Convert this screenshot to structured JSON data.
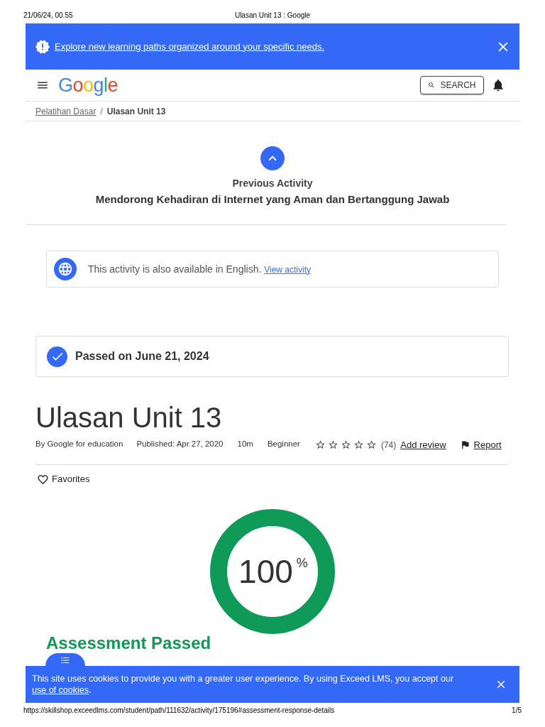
{
  "print_header": {
    "date": "21/06/24, 00.55",
    "title": "Ulasan Unit 13 : Google"
  },
  "announcement": {
    "text": "Explore new learning paths organized around your specific needs."
  },
  "nav": {
    "logo": "Google",
    "search_button": "SEARCH"
  },
  "breadcrumb": {
    "separator": "/",
    "items": [
      {
        "label": "Pelatihan Dasar",
        "kind": "link"
      },
      {
        "label": "Ulasan Unit 13",
        "kind": "current"
      }
    ]
  },
  "previous_activity": {
    "label": "Previous Activity",
    "title": "Mendorong Kehadiran di Internet yang Aman dan Bertanggung Jawab"
  },
  "language_notice": {
    "text": "This activity is also available in English.",
    "link": "View activity"
  },
  "status": {
    "text": "Passed on June 21, 2024"
  },
  "title": "Ulasan Unit 13",
  "meta": {
    "author": "By Google for education",
    "published": "Published: Apr 27, 2020",
    "duration": "10m",
    "difficulty": "Beginner",
    "rating": {
      "stars": 0,
      "count": "(74)"
    },
    "add_review": "Add review",
    "report": "Report"
  },
  "favorites": {
    "label": "Favorites",
    "on": false
  },
  "score": {
    "level": 1,
    "value": "100",
    "unit": "%"
  },
  "result": {
    "title": "Assessment Passed"
  },
  "cookie_banner": {
    "text": "This site uses cookies to provide you with a greater user experience. By using Exceed LMS, you accept our",
    "link": "use of cookies",
    "suffix": "."
  },
  "print_footer": {
    "url": "https://skillshop.exceedlms.com/student/path/111632/activity/175196#assessment-response-details",
    "page": "1/5"
  }
}
